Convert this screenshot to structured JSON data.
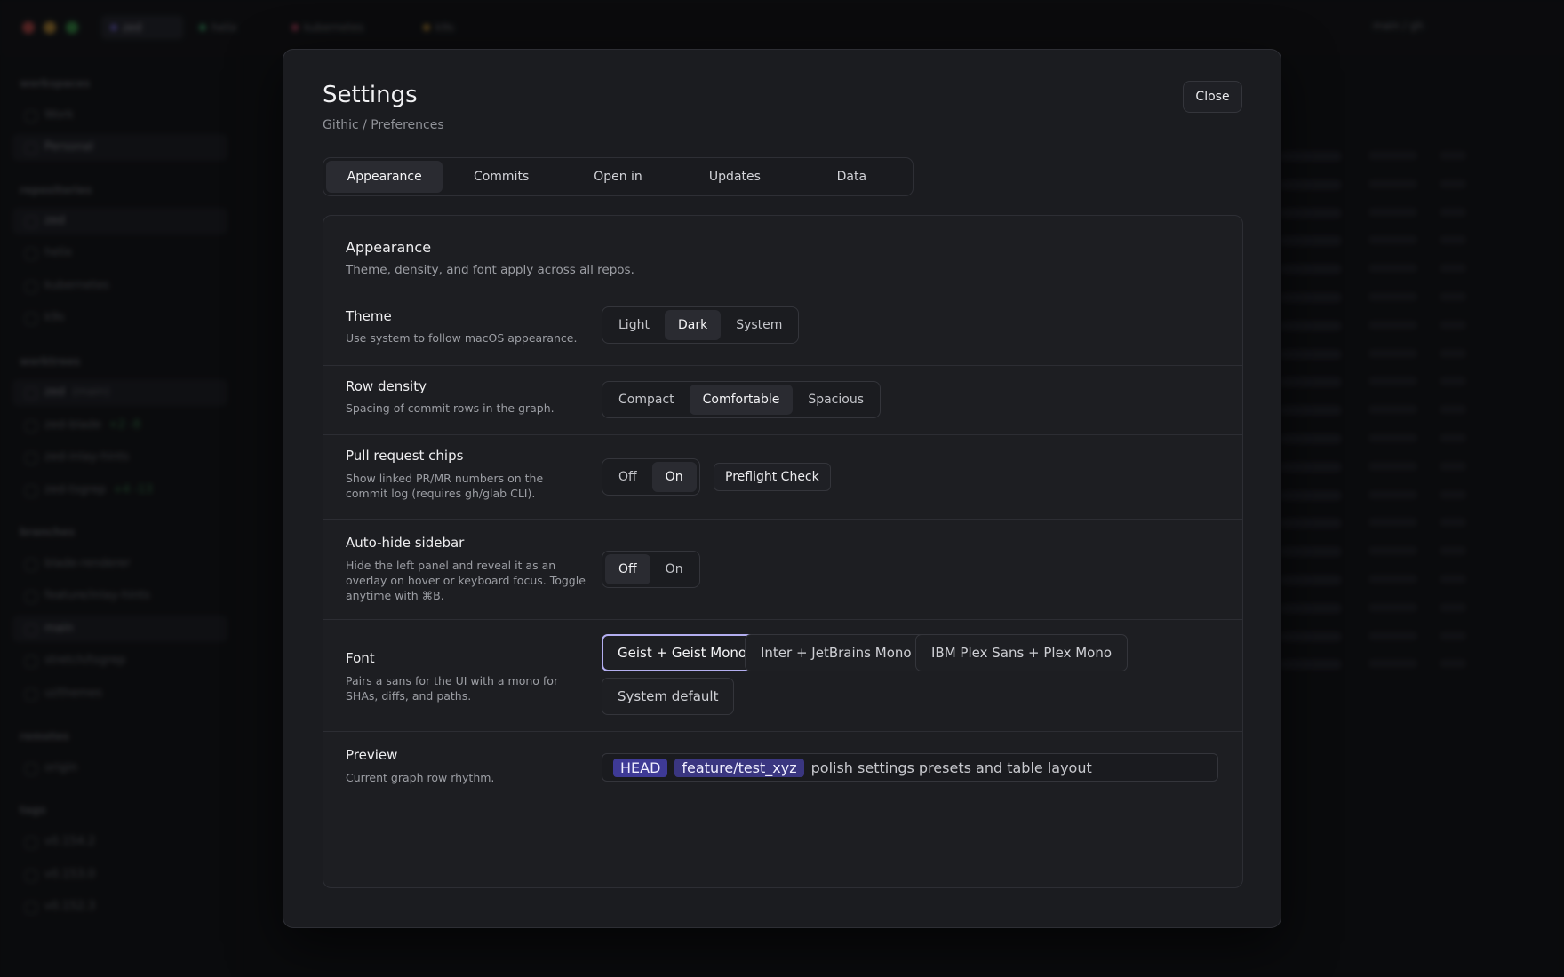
{
  "background": {
    "tabs": [
      {
        "label": "zed",
        "color": "#7b6fe0"
      },
      {
        "label": "helix",
        "color": "#3fae6f"
      },
      {
        "label": "kubernetes",
        "color": "#d94f6f"
      },
      {
        "label": "k9s",
        "color": "#d9a23a"
      }
    ],
    "branch_indicator": "main / gh",
    "sidebar": {
      "sections": [
        "workspaces",
        "repositories",
        "worktrees",
        "branches",
        "remotes",
        "tags"
      ],
      "items": [
        {
          "label": "Work"
        },
        {
          "label": "Personal"
        },
        {
          "label": "zed"
        },
        {
          "label": "helix"
        },
        {
          "label": "kubernetes"
        },
        {
          "label": "k9s"
        },
        {
          "label": "zed",
          "extra": "(main)"
        },
        {
          "label": "zed-blade",
          "extra": "+2 -8"
        },
        {
          "label": "zed-inlay-hints"
        },
        {
          "label": "zed-tsgrep",
          "extra": "+4 -13"
        },
        {
          "label": "blade-renderer"
        },
        {
          "label": "feature/inlay-hints"
        },
        {
          "label": "main"
        },
        {
          "label": "stretch/tsgrep"
        },
        {
          "label": "ui/themes"
        },
        {
          "label": "origin"
        },
        {
          "label": "v0.154.2"
        },
        {
          "label": "v0.153.0"
        },
        {
          "label": "v0.152.3"
        }
      ]
    }
  },
  "modal": {
    "title": "Settings",
    "subtitle": "Githic / Preferences",
    "close_label": "Close",
    "tabs": [
      {
        "label": "Appearance",
        "active": true
      },
      {
        "label": "Commits",
        "active": false
      },
      {
        "label": "Open in",
        "active": false
      },
      {
        "label": "Updates",
        "active": false
      },
      {
        "label": "Data",
        "active": false
      }
    ],
    "section": {
      "title": "Appearance",
      "description": "Theme, density, and font apply across all repos."
    },
    "theme": {
      "label": "Theme",
      "description": "Use system to follow macOS appearance.",
      "options": [
        "Light",
        "Dark",
        "System"
      ],
      "selected": "Dark"
    },
    "row_density": {
      "label": "Row density",
      "description": "Spacing of commit rows in the graph.",
      "options": [
        "Compact",
        "Comfortable",
        "Spacious"
      ],
      "selected": "Comfortable"
    },
    "pr_chips": {
      "label": "Pull request chips",
      "description": "Show linked PR/MR numbers on the commit log (requires gh/glab CLI).",
      "options": [
        "Off",
        "On"
      ],
      "selected": "On",
      "preflight_label": "Preflight Check"
    },
    "autohide_sidebar": {
      "label": "Auto-hide sidebar",
      "description": "Hide the left panel and reveal it as an overlay on hover or keyboard focus. Toggle anytime with ⌘B.",
      "options": [
        "Off",
        "On"
      ],
      "selected": "Off"
    },
    "font": {
      "label": "Font",
      "description": "Pairs a sans for the UI with a mono for SHAs, diffs, and paths.",
      "options": [
        "Geist + Geist Mono",
        "Inter + JetBrains Mono",
        "IBM Plex Sans + Plex Mono",
        "System default"
      ],
      "selected": "Geist + Geist Mono"
    },
    "preview": {
      "label": "Preview",
      "description": "Current graph row rhythm.",
      "head_ref": "HEAD",
      "branch_ref": "feature/test_xyz",
      "message": "polish settings presets and table layout"
    }
  },
  "colors": {
    "accent": "#b3aef0",
    "ref_chip": "#3e3a96",
    "modal_bg": "#1b1c20",
    "page_bg": "#0f1013"
  }
}
